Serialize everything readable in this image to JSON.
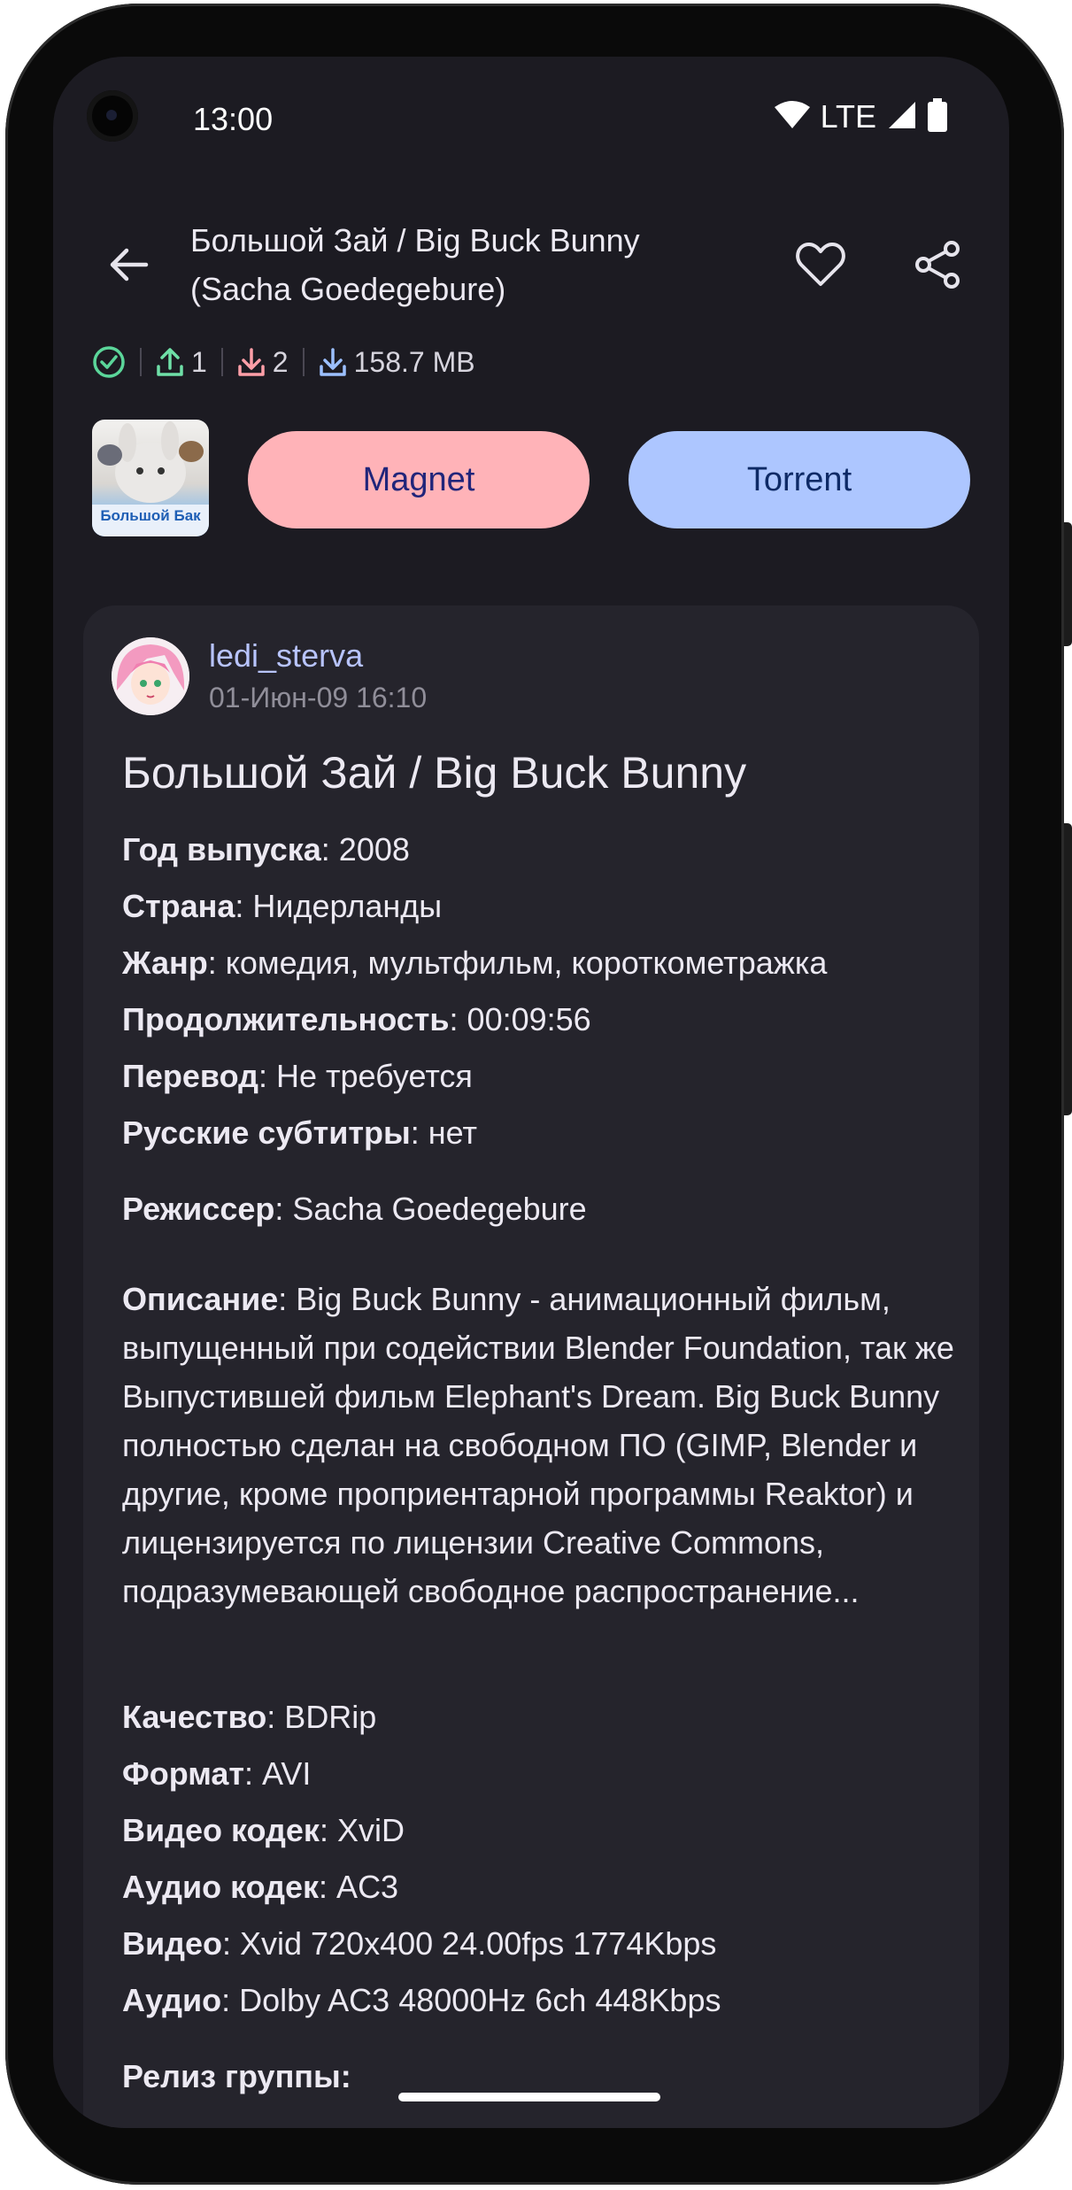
{
  "status": {
    "time": "13:00",
    "network": "LTE"
  },
  "header": {
    "title": "Большой Зай / Big Buck Bunny (Sacha Goedegebure)"
  },
  "stats": {
    "seeders": "1",
    "leechers": "2",
    "size": "158.7 MB"
  },
  "actions": {
    "magnet_label": "Magnet",
    "torrent_label": "Torrent"
  },
  "post": {
    "author": "ledi_sterva",
    "date": "01-Июн-09 16:10",
    "title": "Большой Зай / Big Buck Bunny",
    "fields": [
      {
        "label": "Год выпуска",
        "value": ": 2008"
      },
      {
        "label": "Страна",
        "value": ": Нидерланды"
      },
      {
        "label": "Жанр",
        "value": ": комедия, мультфильм, короткометражка"
      },
      {
        "label": "Продолжительность",
        "value": ": 00:09:56"
      },
      {
        "label": "Перевод",
        "value": ": Не требуется"
      },
      {
        "label": "Русские субтитры",
        "value": ": нет"
      },
      {
        "label": "Режиссер",
        "value": ": Sacha Goedegebure"
      }
    ],
    "description_label": "Описание",
    "description": ": Big Buck Bunny - анимационный фильм, выпущенный при содействии Blender Foundation, так же Выпустившей фильм Elephant's Dream. Big Buck Bunny полностью сделан на свободном ПО (GIMP, Blender и другие, кроме проприентарной программы Reaktor) и лицензируется по лицензии Creative Commons, подразумевающей свободное распространение...",
    "tech": [
      {
        "label": "Качество",
        "value": ": BDRip"
      },
      {
        "label": "Формат",
        "value": ": AVI"
      },
      {
        "label": "Видео кодек",
        "value": ": XviD"
      },
      {
        "label": "Аудио кодек",
        "value": ": AC3"
      },
      {
        "label": "Видео",
        "value": ": Xvid 720x400 24.00fps 1774Kbps"
      },
      {
        "label": "Аудио",
        "value": ": Dolby AC3 48000Hz 6ch 448Kbps"
      }
    ],
    "release_group_label": "Релиз группы:"
  },
  "thumb_text": "Большой Бак",
  "colors": {
    "background": "#1c1b22",
    "card": "#25242c",
    "magnet": "#ffb3b8",
    "torrent": "#adc6ff",
    "author": "#b8c4ff",
    "check": "#5bd69a",
    "upload": "#6fe0a8",
    "download": "#ff9fa8",
    "size": "#9cc0ff"
  },
  "icons": [
    "back-arrow-icon",
    "heart-icon",
    "share-icon",
    "check-circle-icon",
    "upload-icon",
    "download-icon",
    "download-size-icon",
    "wifi-icon",
    "signal-icon",
    "battery-icon"
  ]
}
